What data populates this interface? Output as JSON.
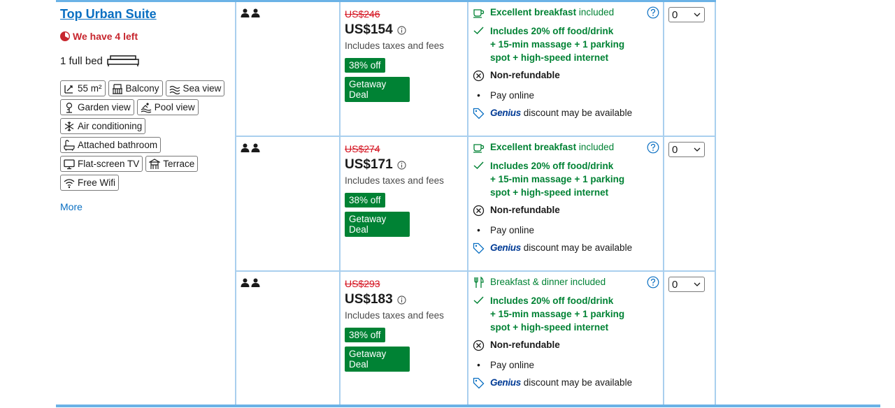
{
  "room": {
    "title": "Top Urban Suite",
    "scarcity": "We have 4 left",
    "bed": "1 full bed",
    "facilities": [
      {
        "icon": "size-icon",
        "label": "55 m²"
      },
      {
        "icon": "balcony-icon",
        "label": "Balcony"
      },
      {
        "icon": "sea-view-icon",
        "label": "Sea view"
      },
      {
        "icon": "garden-view-icon",
        "label": "Garden view"
      },
      {
        "icon": "pool-view-icon",
        "label": "Pool view"
      },
      {
        "icon": "snowflake-icon",
        "label": "Air conditioning"
      },
      {
        "icon": "bathtub-icon",
        "label": "Attached bathroom"
      },
      {
        "icon": "tv-icon",
        "label": "Flat-screen TV"
      },
      {
        "icon": "terrace-icon",
        "label": "Terrace"
      },
      {
        "icon": "wifi-icon",
        "label": "Free Wifi"
      }
    ],
    "more_link": "More"
  },
  "options": [
    {
      "old_price": "US$246",
      "price": "US$154",
      "taxes": "Includes taxes and fees",
      "discount": "38% off",
      "deal": "Getaway Deal",
      "meal_bold": "Excellent breakfast",
      "meal_rest": " included",
      "meal_icon": "coffee-icon",
      "includes": [
        "Includes 20% off food/drink",
        "+ 15-min massage + 1 parking",
        "spot + high-speed internet"
      ],
      "refund": "Non-refundable",
      "pay": "Pay online",
      "genius_word": "Genius",
      "genius_rest": "discount may be available",
      "qty": "0"
    },
    {
      "old_price": "US$274",
      "price": "US$171",
      "taxes": "Includes taxes and fees",
      "discount": "38% off",
      "deal": "Getaway Deal",
      "meal_bold": "Excellent breakfast",
      "meal_rest": " included",
      "meal_icon": "coffee-icon",
      "includes": [
        "Includes 20% off food/drink",
        "+ 15-min massage + 1 parking",
        "spot + high-speed internet"
      ],
      "refund": "Non-refundable",
      "pay": "Pay online",
      "genius_word": "Genius",
      "genius_rest": "discount may be available",
      "qty": "0"
    },
    {
      "old_price": "US$293",
      "price": "US$183",
      "taxes": "Includes taxes and fees",
      "discount": "38% off",
      "deal": "Getaway Deal",
      "meal_bold": "",
      "meal_rest": "Breakfast & dinner included",
      "meal_icon": "cutlery-icon",
      "includes": [
        "Includes 20% off food/drink",
        "+ 15-min massage + 1 parking",
        "spot + high-speed internet"
      ],
      "refund": "Non-refundable",
      "pay": "Pay online",
      "genius_word": "Genius",
      "genius_rest": "discount may be available",
      "qty": "0"
    }
  ],
  "colors": {
    "link": "#0a6fc2",
    "green": "#008234",
    "red": "#d4111e",
    "border": "#6bb2e6"
  }
}
